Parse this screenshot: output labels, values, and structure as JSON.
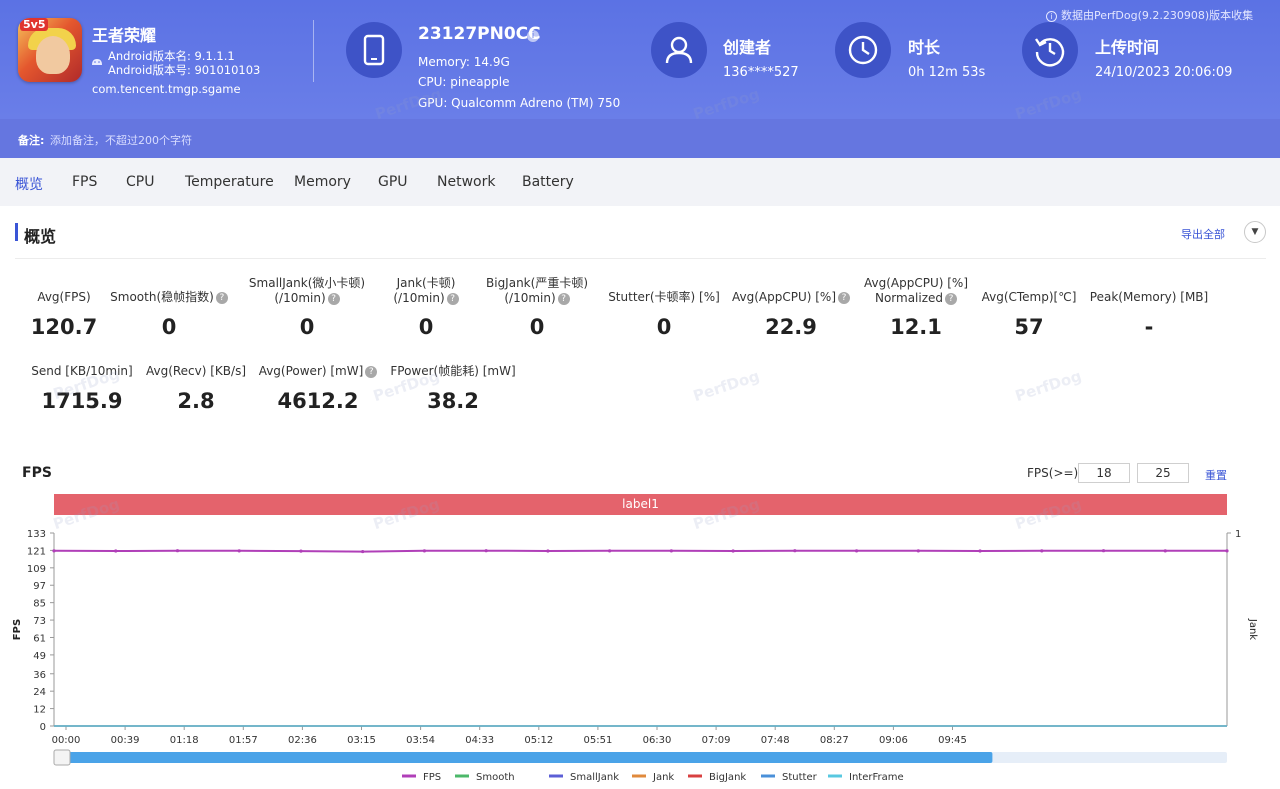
{
  "source_note": "数据由PerfDog(9.2.230908)版本收集",
  "app": {
    "name": "王者荣耀",
    "icon_badge": "5v5",
    "version_name": "Android版本名: 9.1.1.1",
    "version_code": "Android版本号: 901010103",
    "package": "com.tencent.tmgp.sgame"
  },
  "device": {
    "name": "23127PN0CC",
    "memory": "Memory: 14.9G",
    "cpu": "CPU: pineapple",
    "gpu": "GPU: Qualcomm Adreno (TM) 750"
  },
  "creator": {
    "title": "创建者",
    "value": "136****527"
  },
  "duration": {
    "title": "时长",
    "value": "0h 12m 53s"
  },
  "upload": {
    "title": "上传时间",
    "value": "24/10/2023 20:06:09"
  },
  "note": {
    "label": "备注:",
    "placeholder": "添加备注，不超过200个字符"
  },
  "tabs": [
    "概览",
    "FPS",
    "CPU",
    "Temperature",
    "Memory",
    "GPU",
    "Network",
    "Battery"
  ],
  "overview": {
    "title": "概览",
    "export_label": "导出全部",
    "metrics": [
      {
        "label": "Avg(FPS)",
        "value": "120.7"
      },
      {
        "label": "Smooth(稳帧指数)",
        "value": "0"
      },
      {
        "label": "SmallJank(微小卡顿)",
        "label2": "(/10min)",
        "value": "0"
      },
      {
        "label": "Jank(卡顿)",
        "label2": "(/10min)",
        "value": "0"
      },
      {
        "label": "BigJank(严重卡顿)",
        "label2": "(/10min)",
        "value": "0"
      },
      {
        "label": "Stutter(卡顿率) [%]",
        "value": "0"
      },
      {
        "label": "Avg(AppCPU) [%]",
        "value": "22.9"
      },
      {
        "label": "Avg(AppCPU) [%]",
        "label2": "Normalized",
        "value": "12.1"
      },
      {
        "label": "Avg(CTemp)[℃]",
        "value": "57"
      },
      {
        "label": "Peak(Memory) [MB]",
        "value": "-"
      },
      {
        "label": "Send [KB/10min]",
        "value": "1715.9"
      },
      {
        "label": "Avg(Recv) [KB/s]",
        "value": "2.8"
      },
      {
        "label": "Avg(Power) [mW]",
        "value": "4612.2"
      },
      {
        "label": "FPower(帧能耗) [mW]",
        "value": "38.2"
      }
    ]
  },
  "fps_panel": {
    "title": "FPS",
    "threshold_label": "FPS(>=)",
    "threshold_low": "18",
    "threshold_high": "25",
    "reset_label": "重置",
    "label_bar": "label1"
  },
  "watermark": "PerfDog",
  "colors": {
    "header": "#5b72e4",
    "accent": "#3a55d6",
    "label_bar": "#e4636c",
    "fps_line": "#b03fb8",
    "slider": "#4aa3e8"
  },
  "chart_data": {
    "type": "line",
    "x": [
      "00:00",
      "00:39",
      "01:18",
      "01:57",
      "02:36",
      "03:15",
      "03:54",
      "04:33",
      "05:12",
      "05:51",
      "06:30",
      "07:09",
      "07:48",
      "08:27",
      "09:06",
      "09:45"
    ],
    "y_ticks": [
      0,
      12,
      24,
      36,
      49,
      61,
      73,
      85,
      97,
      109,
      121,
      133
    ],
    "ylim": [
      0,
      133
    ],
    "ylabel": "FPS",
    "y2label": "Jank",
    "y2_ticks": [
      1
    ],
    "series": [
      {
        "name": "FPS",
        "color": "#b03fb8",
        "values": [
          120.7,
          120.6,
          120.8,
          120.7,
          120.5,
          120.2,
          120.7,
          120.8,
          120.6,
          120.7,
          120.7,
          120.6,
          120.8,
          120.7,
          120.7,
          120.6,
          120.7,
          120.8,
          120.7,
          120.7
        ]
      },
      {
        "name": "Smooth",
        "color": "#4cb86a",
        "values": [
          0,
          0,
          0,
          0,
          0,
          0,
          0,
          0,
          0,
          0,
          0,
          0,
          0,
          0,
          0,
          0,
          0,
          0,
          0,
          0
        ]
      },
      {
        "name": "SmallJank",
        "color": "#5c5fd6",
        "values": [
          0,
          0,
          0,
          0,
          0,
          0,
          0,
          0,
          0,
          0,
          0,
          0,
          0,
          0,
          0,
          0,
          0,
          0,
          0,
          0
        ]
      },
      {
        "name": "Jank",
        "color": "#e08a3c",
        "values": [
          0,
          0,
          0,
          0,
          0,
          0,
          0,
          0,
          0,
          0,
          0,
          0,
          0,
          0,
          0,
          0,
          0,
          0,
          0,
          0
        ]
      },
      {
        "name": "BigJank",
        "color": "#d84040",
        "values": [
          0,
          0,
          0,
          0,
          0,
          0,
          0,
          0,
          0,
          0,
          0,
          0,
          0,
          0,
          0,
          0,
          0,
          0,
          0,
          0
        ]
      },
      {
        "name": "Stutter",
        "color": "#4a90d9",
        "values": [
          0,
          0,
          0,
          0,
          0,
          0,
          0,
          0,
          0,
          0,
          0,
          0,
          0,
          0,
          0,
          0,
          0,
          0,
          0,
          0
        ]
      },
      {
        "name": "InterFrame",
        "color": "#58c8e0",
        "values": [
          0,
          0,
          0,
          0,
          0,
          0,
          0,
          0,
          0,
          0,
          0,
          0,
          0,
          0,
          0,
          0,
          0,
          0,
          0,
          0
        ]
      }
    ]
  }
}
